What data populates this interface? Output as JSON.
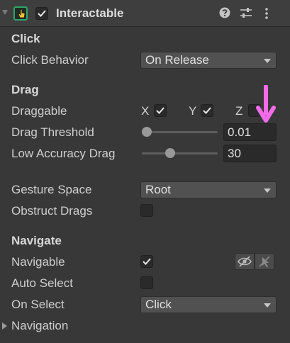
{
  "header": {
    "title": "Interactable",
    "enabled": true
  },
  "sections": {
    "click": {
      "title": "Click"
    },
    "drag": {
      "title": "Drag"
    },
    "navigate": {
      "title": "Navigate"
    }
  },
  "fields": {
    "click_behavior": {
      "label": "Click Behavior",
      "value": "On Release"
    },
    "draggable": {
      "label": "Draggable",
      "x_label": "X",
      "x_checked": true,
      "y_label": "Y",
      "y_checked": true,
      "z_label": "Z",
      "z_checked": false
    },
    "drag_threshold": {
      "label": "Drag Threshold",
      "value": "0.01",
      "slider_fraction": 0.0
    },
    "low_accuracy_drag": {
      "label": "Low Accuracy Drag",
      "value": "30",
      "slider_fraction": 0.35
    },
    "gesture_space": {
      "label": "Gesture Space",
      "value": "Root"
    },
    "obstruct_drags": {
      "label": "Obstruct Drags",
      "checked": false
    },
    "navigable": {
      "label": "Navigable",
      "checked": true
    },
    "auto_select": {
      "label": "Auto Select",
      "checked": false
    },
    "on_select": {
      "label": "On Select",
      "value": "Click"
    },
    "navigation": {
      "label": "Navigation"
    }
  },
  "icons": {
    "component": "hand-pointer-icon",
    "help": "help-icon",
    "presets": "sliders-icon",
    "menu": "kebab-menu-icon",
    "visibility": "eye-slash-icon",
    "pick": "pointer-slash-icon",
    "annotation": "pink-down-arrow-icon"
  },
  "colors": {
    "accent_green": "#2fa36b",
    "annotation_pink": "#f26be8"
  }
}
